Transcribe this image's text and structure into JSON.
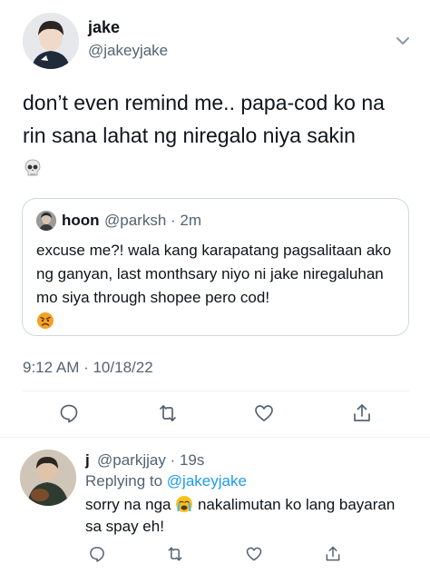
{
  "main_tweet": {
    "display_name": "jake",
    "handle": "@jakeyjake",
    "text": "don’t even remind me.. papa-cod ko na rin sana lahat ng niregalo niya sakin",
    "timestamp": "9:12 AM · 10/18/22",
    "emoji_icon": "skull-icon"
  },
  "quote": {
    "display_name": "hoon",
    "handle_time": "@parksh · 2m",
    "text": "excuse me?! wala kang karapatang pagsalitaan ako ng ganyan, last monthsary niyo ni jake niregaluhan mo siya through shopee pero cod!",
    "emoji_icon": "angry-face-icon"
  },
  "reply": {
    "display_name": "j",
    "handle_time": "@parkjjay · 19s",
    "replying_to_label": "Replying to",
    "replying_to_handle": "@jakeyjake",
    "text_before": "sorry na nga",
    "text_after": "nakalimutan ko lang bayaran sa spay eh!",
    "emoji_icon": "crying-face-icon"
  },
  "colors": {
    "text": "#0f1419",
    "secondary": "#536471",
    "link": "#1d9bf0",
    "border": "#cfd9de",
    "divider": "#eff3f4"
  }
}
